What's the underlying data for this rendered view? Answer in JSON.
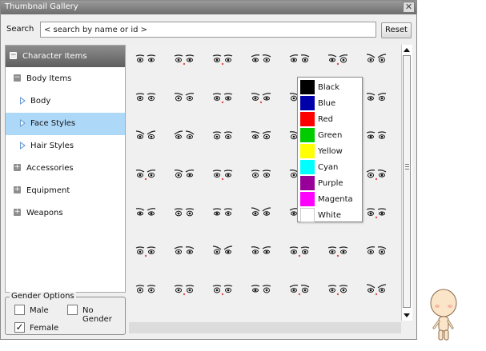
{
  "window": {
    "title": "Thumbnail Gallery",
    "close_symbol": "✕"
  },
  "search": {
    "label": "Search",
    "value": "< search by name or id >",
    "reset_label": "Reset"
  },
  "tree": {
    "category_header": "Character Items",
    "items": [
      {
        "label": "Body Items",
        "kind": "folder-expanded"
      },
      {
        "label": "Body",
        "kind": "leaf"
      },
      {
        "label": "Face Styles",
        "kind": "leaf",
        "selected": true
      },
      {
        "label": "Hair Styles",
        "kind": "leaf"
      },
      {
        "label": "Accessories",
        "kind": "folder-collapsed"
      },
      {
        "label": "Equipment",
        "kind": "folder-collapsed"
      },
      {
        "label": "Weapons",
        "kind": "folder-collapsed"
      }
    ]
  },
  "gender": {
    "legend": "Gender Options",
    "options": [
      {
        "label": "Male",
        "checked": false
      },
      {
        "label": "No Gender",
        "checked": false
      },
      {
        "label": "Female",
        "checked": true
      }
    ]
  },
  "color_menu": {
    "items": [
      {
        "label": "Black",
        "color": "#000000"
      },
      {
        "label": "Blue",
        "color": "#0000aa"
      },
      {
        "label": "Red",
        "color": "#ff0000"
      },
      {
        "label": "Green",
        "color": "#00cc00"
      },
      {
        "label": "Yellow",
        "color": "#ffff00"
      },
      {
        "label": "Cyan",
        "color": "#00ffff"
      },
      {
        "label": "Purple",
        "color": "#990099"
      },
      {
        "label": "Magenta",
        "color": "#ff00ff"
      },
      {
        "label": "White",
        "color": "#ffffff"
      }
    ]
  },
  "icons": {
    "collapse": "−",
    "expand": "+",
    "check": "✓"
  }
}
